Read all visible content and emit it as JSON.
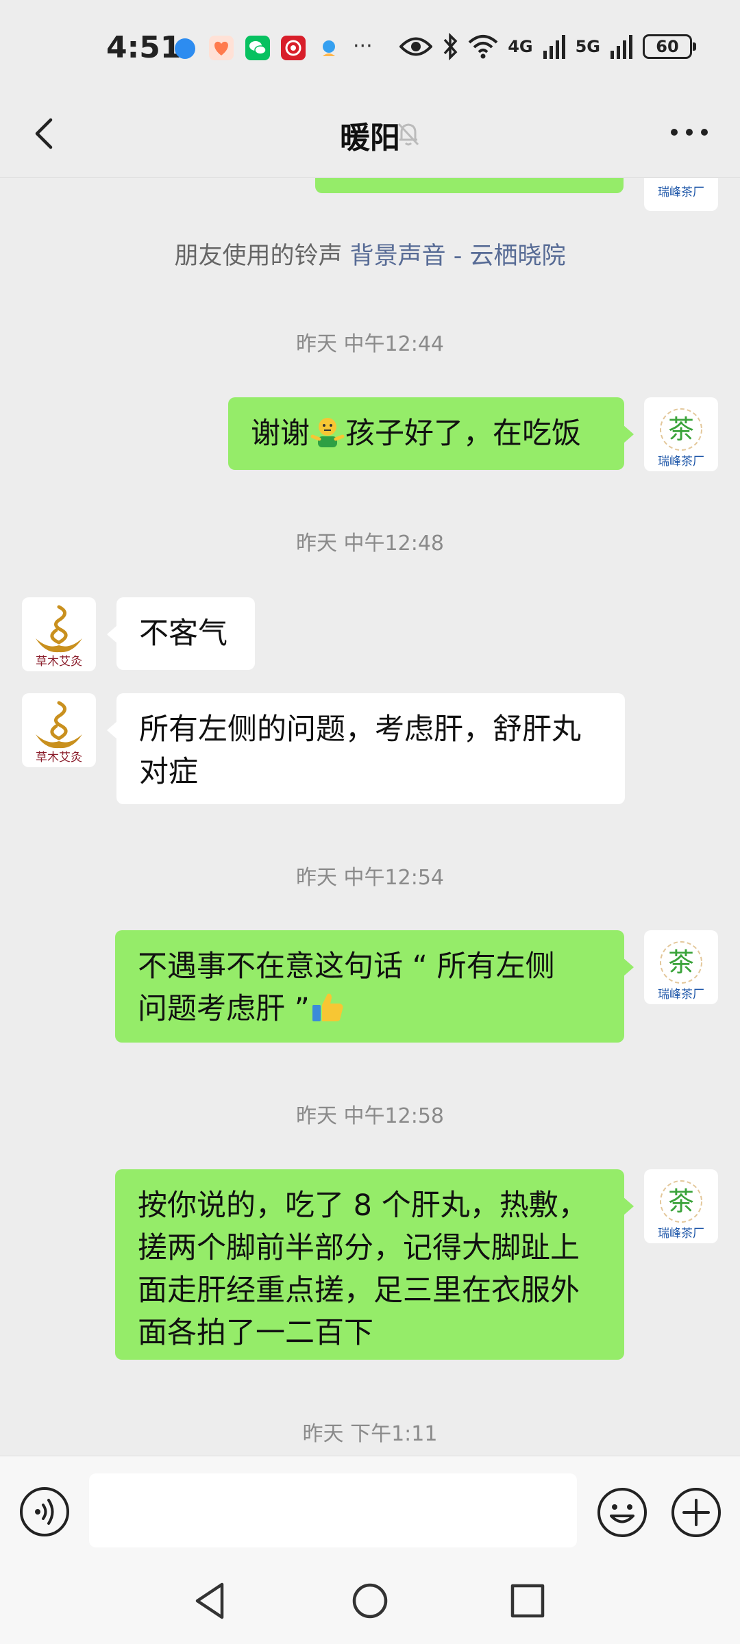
{
  "status_bar": {
    "time": "4:51",
    "more_indicator": "···",
    "net1": "4G",
    "net2": "5G",
    "battery": "60"
  },
  "header": {
    "title": "暖阳"
  },
  "notice": {
    "prefix": "朋友使用的铃声 ",
    "link": "背景声音 - 云栖晓院"
  },
  "avatars": {
    "self_logo_char": "茶",
    "self_logo_text": "瑞峰茶厂",
    "other_logo_text": "草木艾灸"
  },
  "messages": [
    {
      "timestamp": "昨天 中午12:44"
    },
    {
      "from": "self",
      "text_before": "谢谢",
      "text_after": "孩子好了，在吃饭"
    },
    {
      "timestamp": "昨天 中午12:48"
    },
    {
      "from": "other",
      "text": "不客气"
    },
    {
      "from": "other",
      "text_line1": "所有左侧的问题，考虑肝，舒肝丸",
      "text_line2": "对症"
    },
    {
      "timestamp": "昨天 中午12:54"
    },
    {
      "from": "self",
      "text_line1": "不遇事不在意这句话 “ 所有左侧",
      "text_line2": "问题考虑肝 ”"
    },
    {
      "timestamp": "昨天 中午12:58"
    },
    {
      "from": "self",
      "lines": [
        "按你说的，吃了 8 个肝丸，热敷，",
        "搓两个脚前半部分，记得大脚趾上",
        "面走肝经重点搓，足三里在衣服外",
        "面各拍了一二百下"
      ]
    },
    {
      "timestamp": "昨天 下午1:11"
    }
  ],
  "icons": {
    "back": "chevron-left-icon",
    "mute": "bell-off-icon",
    "more": "ellipsis-icon",
    "voice": "voice-icon",
    "emoji": "smiley-icon",
    "plus": "plus-icon",
    "emoji_in_text_1": "shrug-emoji",
    "emoji_in_text_2": "thumbs-up-emoji"
  },
  "colors": {
    "background": "#ededed",
    "bubble_out": "#95ec69",
    "bubble_in": "#ffffff",
    "link": "#576b95",
    "timestamp": "#8a8a8a",
    "logo_green": "#3aa33a",
    "logo_gold": "#c9901e",
    "logo_maroon": "#8a1c2a"
  }
}
